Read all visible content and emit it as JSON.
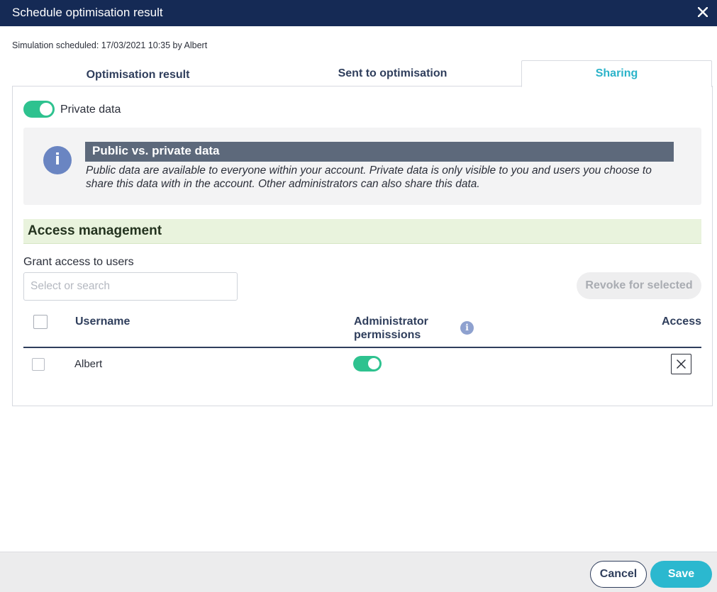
{
  "dialog": {
    "title": "Schedule optimisation result",
    "scheduled_text": "Simulation scheduled: 17/03/2021 10:35 by Albert"
  },
  "tabs": [
    {
      "label": "Optimisation result",
      "active": false
    },
    {
      "label": "Sent to optimisation",
      "active": false
    },
    {
      "label": "Sharing",
      "active": true
    }
  ],
  "sharing": {
    "private_toggle": {
      "label": "Private data",
      "on": true
    },
    "info": {
      "icon": "info-icon",
      "heading": "Public vs. private data",
      "body": "Public data are available to everyone within your account. Private data is only visible to you and users you choose to share this data with in the account. Other administrators can also share this data."
    },
    "access": {
      "heading": "Access management",
      "grant_label": "Grant access to users",
      "search_placeholder": "Select or search",
      "revoke_label": "Revoke for selected",
      "columns": {
        "username": "Username",
        "admin": "Administrator permissions",
        "access": "Access"
      },
      "rows": [
        {
          "username": "Albert",
          "admin": true,
          "checked": false
        }
      ]
    }
  },
  "footer": {
    "cancel_label": "Cancel",
    "save_label": "Save"
  },
  "colors": {
    "titlebar": "#152a55",
    "accent": "#2bb8cf",
    "toggle_on": "#2ec28f",
    "info_icon": "#6a85c2",
    "access_header_bg": "#e9f3dd"
  }
}
